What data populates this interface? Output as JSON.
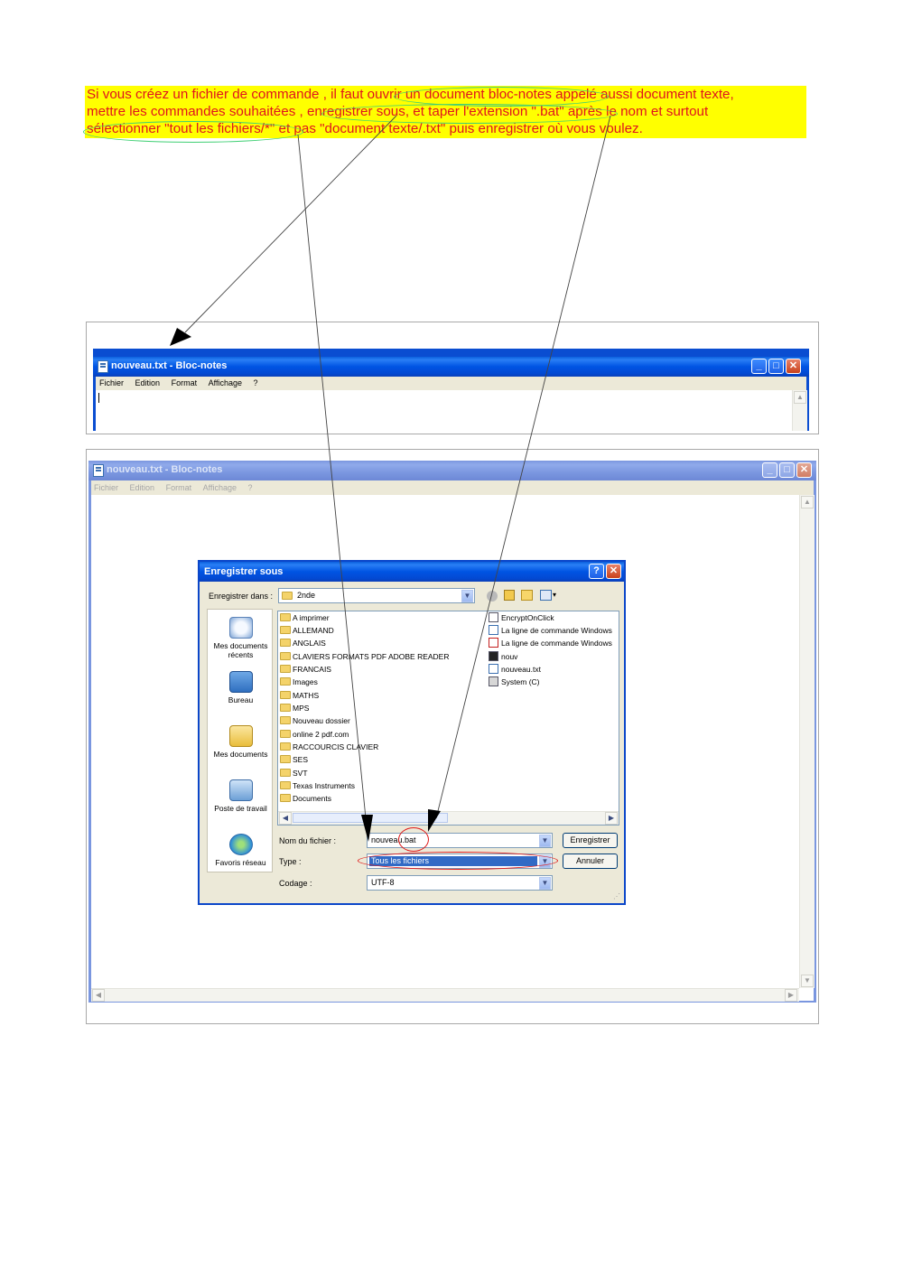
{
  "instruction": {
    "line1": "Si vous créez un fichier de commande , il faut ouvrir un document bloc-notes appelé aussi document texte,",
    "line2": "mettre les commandes souhaitées , enregistrer sous, et taper l'extension \".bat\" après le nom et surtout",
    "line3": "sélectionner \"tout les fichiers/*\" et pas \"document texte/.txt\" puis enregistrer où vous voulez."
  },
  "notepad_small": {
    "title": "nouveau.txt - Bloc-notes",
    "menu": [
      "Fichier",
      "Edition",
      "Format",
      "Affichage",
      "?"
    ],
    "minimize": "_",
    "maximize": "□",
    "close": "✕"
  },
  "notepad_large": {
    "title": "nouveau.txt - Bloc-notes",
    "menu": [
      "Fichier",
      "Edition",
      "Format",
      "Affichage",
      "?"
    ]
  },
  "save_dialog": {
    "title": "Enregistrer sous",
    "help": "?",
    "close": "✕",
    "save_in_label": "Enregistrer dans :",
    "save_in_value": "2nde",
    "places": [
      "Mes documents récents",
      "Bureau",
      "Mes documents",
      "Poste de travail",
      "Favoris réseau"
    ],
    "folders": [
      "A imprimer",
      "ALLEMAND",
      "ANGLAIS",
      "CLAVIERS FORMATS PDF ADOBE READER",
      "FRANCAIS",
      "Images",
      "MATHS",
      "MPS",
      "Nouveau dossier",
      "online 2 pdf.com",
      "RACCOURCIS CLAVIER",
      "SES",
      "SVT",
      "Texas Instruments",
      "Documents"
    ],
    "files": [
      "EncryptOnClick",
      "La ligne de commande Windows",
      "La ligne de commande Windows",
      "nouv",
      "nouveau.txt",
      "System (C)"
    ],
    "filename_label": "Nom du fichier :",
    "filename_value": "nouveau.bat",
    "type_label": "Type :",
    "type_value": "Tous les fichiers",
    "encoding_label": "Codage :",
    "encoding_value": "UTF-8",
    "save_button": "Enregistrer",
    "cancel_button": "Annuler"
  },
  "colors": {
    "highlight": "#ffff00",
    "note_text": "#e0141e",
    "xp_blue": "#0054e3",
    "ring_green": "#3fcf73",
    "ring_red": "#e01818"
  }
}
